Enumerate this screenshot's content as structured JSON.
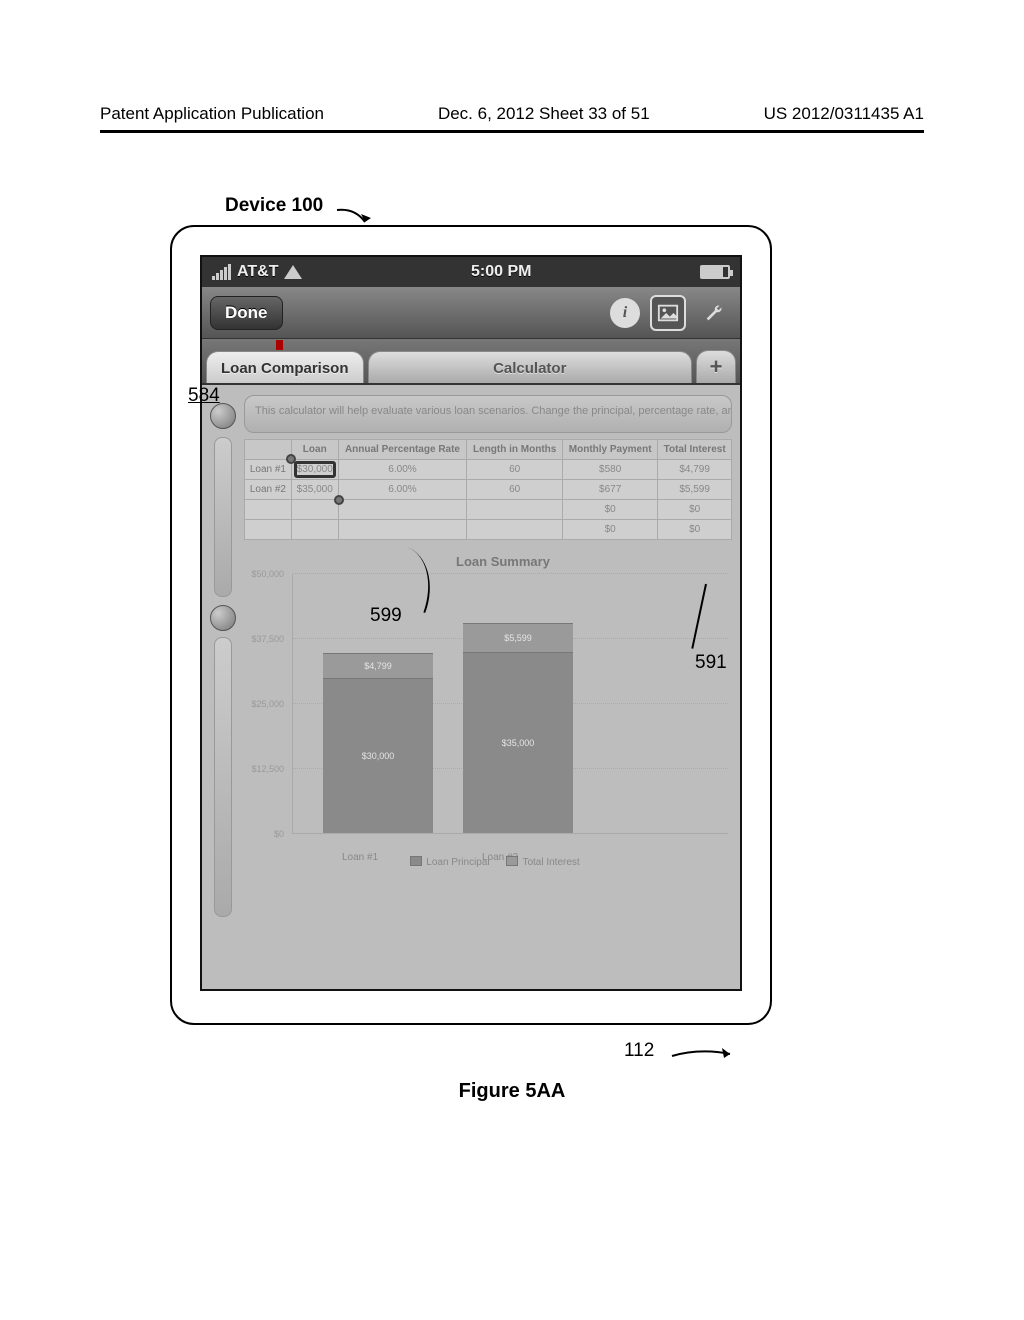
{
  "page_header": {
    "left": "Patent Application Publication",
    "center": "Dec. 6, 2012   Sheet 33 of 51",
    "right": "US 2012/0311435 A1"
  },
  "device_label": "Device 100",
  "figure_caption": "Figure 5AA",
  "callouts": {
    "c584": "584",
    "c599": "599",
    "c591": "591",
    "c112": "112"
  },
  "statusbar": {
    "carrier": "AT&T",
    "time": "5:00 PM"
  },
  "navbar": {
    "done": "Done"
  },
  "tabs": {
    "loan_comparison": "Loan Comparison",
    "calculator": "Calculator",
    "add": "+"
  },
  "intro_text": "This calculator will help evaluate various loan scenarios. Change the principal, percentage rate, and length of each loan, and the payments will automatically…",
  "table": {
    "headers": {
      "loan": "Loan",
      "apr": "Annual Percentage Rate",
      "length": "Length in Months",
      "payment": "Monthly Payment",
      "interest": "Total Interest"
    },
    "rows": [
      {
        "label": "Loan #1",
        "loan": "$30,000",
        "apr": "6.00%",
        "length": "60",
        "payment": "$580",
        "interest": "$4,799"
      },
      {
        "label": "Loan #2",
        "loan": "$35,000",
        "apr": "6.00%",
        "length": "60",
        "payment": "$677",
        "interest": "$5,599"
      },
      {
        "label": "",
        "loan": "",
        "apr": "",
        "length": "",
        "payment": "$0",
        "interest": "$0"
      },
      {
        "label": "",
        "loan": "",
        "apr": "",
        "length": "",
        "payment": "$0",
        "interest": "$0"
      }
    ]
  },
  "chart_title": "Loan Summary",
  "chart_data": {
    "type": "bar",
    "stacked": true,
    "categories": [
      "Loan #1",
      "Loan #2"
    ],
    "series": [
      {
        "name": "Loan Principal",
        "values": [
          30000,
          35000
        ]
      },
      {
        "name": "Total Interest",
        "values": [
          4799,
          5599
        ]
      }
    ],
    "bar_labels": [
      {
        "principal": "$30,000",
        "interest": "$4,799"
      },
      {
        "principal": "$35,000",
        "interest": "$5,599"
      }
    ],
    "title": "Loan Summary",
    "xlabel": "",
    "ylabel": "",
    "yticks": [
      "$0",
      "$12,500",
      "$25,000",
      "$37,500",
      "$50,000"
    ],
    "ylim": [
      0,
      50000
    ],
    "legend": [
      "Loan Principal",
      "Total Interest"
    ]
  }
}
